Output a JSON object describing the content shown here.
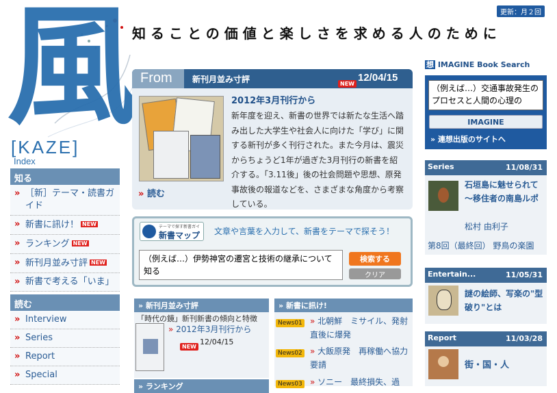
{
  "header": {
    "logo_kanji": "風",
    "brand": "[KAZE]",
    "index_label": "Index",
    "updated": "更新：月２回",
    "tagline": "知ることの価値と楽しさを求める人のために"
  },
  "nav": {
    "section1": {
      "title": "知る",
      "items": [
        {
          "label": "［新］テーマ・読書ガイド",
          "badge": ""
        },
        {
          "label": "新書に訊け！",
          "badge": "NEW"
        },
        {
          "label": "ランキング",
          "badge": "NEW"
        },
        {
          "label": "新刊月並み寸評",
          "badge": "NEW"
        },
        {
          "label": "新書で考える「いま」",
          "badge": ""
        }
      ]
    },
    "section2": {
      "title": "読む",
      "items": [
        {
          "label": "Interview"
        },
        {
          "label": "Series"
        },
        {
          "label": "Report"
        },
        {
          "label": "Special"
        }
      ]
    }
  },
  "from_panel": {
    "label": "From",
    "title": "新刊月並み寸評",
    "new_badge": "NEW",
    "date": "12/04/15",
    "subtitle": "2012年3月刊行から",
    "body": "新年度を迎え、新書の世界では新たな生活へ踏み出した大学生や社会人に向けた「学び」に関する新刊が多く刊行された。また今月は、震災からちょうど1年が過ぎた3月刊行の新書を紹介する。「3.11後」後の社会問題や思想、原発事故後の報道などを、さまざまな角度から考察している。",
    "read_link": "読む"
  },
  "search": {
    "logo_small": "テーマで探す新書ガイド",
    "logo_big": "新書マップ",
    "prompt": "文章や言葉を入力して、新書をテーマで探そう！",
    "input_value": "（例えば…）伊勢神宮の遷宮と技術の継承について知る",
    "search_button": "検索する",
    "clear_button": "クリア"
  },
  "col_review": {
    "header": "新刊月並み寸評",
    "kicker": "「時代の鏡」新刊新書の傾向と特徴",
    "link": "2012年3月刊行から",
    "badge": "NEW",
    "date": "12/04/15"
  },
  "col_news": {
    "header": "新書に訊け!",
    "items": [
      {
        "tag": "News01",
        "text": "北朝鮮　ミサイル、発射直後に爆発"
      },
      {
        "tag": "News02",
        "text": "大飯原発　再稼働へ協力要請"
      },
      {
        "tag": "News03",
        "text": "ソニー　最終損失、過"
      }
    ]
  },
  "col_ranking": {
    "header": "ランキング"
  },
  "imagine": {
    "header_icon": "想",
    "header": "IMAGINE Book Search",
    "input_value": "（例えば…）交通事故発生のプロセスと人間の心理の",
    "button": "IMAGINE",
    "link": "連想出版のサイトへ"
  },
  "sidebar": {
    "series": {
      "title": "Series",
      "date": "11/08/31",
      "headline": "石垣島に魅せられて 〜移住者の南島ルポ",
      "author": "松村 由利子",
      "episode": "第8回（最終回） 野鳥の楽園"
    },
    "entertain": {
      "title": "Entertain...",
      "date": "11/05/31",
      "headline": "謎の絵師、写楽の\"型破り\"とは"
    },
    "report": {
      "title": "Report",
      "date": "11/03/28",
      "headline": "街・国・人"
    }
  },
  "colors": {
    "accent_blue": "#2a6fae",
    "nav_head": "#6a90b4",
    "panel_head": "#2f5f8f",
    "new_red": "#e0201c",
    "search_orange": "#f0761e"
  }
}
